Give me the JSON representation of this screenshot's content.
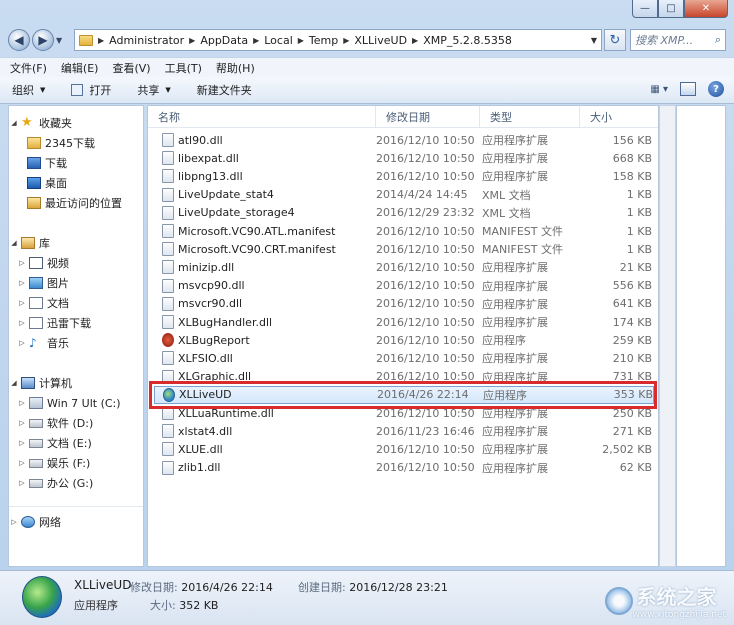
{
  "window": {
    "minimize": "—",
    "maximize": "□",
    "close": "✕"
  },
  "address": {
    "crumbs": [
      "Administrator",
      "AppData",
      "Local",
      "Temp",
      "XLLiveUD",
      "XMP_5.2.8.5358"
    ],
    "search_placeholder": "搜索 XMP..."
  },
  "menu": [
    "文件(F)",
    "编辑(E)",
    "查看(V)",
    "工具(T)",
    "帮助(H)"
  ],
  "toolbar": {
    "organize": "组织",
    "open": "打开",
    "share": "共享",
    "new_folder": "新建文件夹"
  },
  "nav": {
    "favorites": "收藏夹",
    "fav_items": [
      "2345下载",
      "下载",
      "桌面",
      "最近访问的位置"
    ],
    "library": "库",
    "lib_items": [
      "视频",
      "图片",
      "文档",
      "迅雷下载",
      "音乐"
    ],
    "computer": "计算机",
    "drives": [
      "Win 7 Ult (C:)",
      "软件 (D:)",
      "文档 (E:)",
      "娱乐 (F:)",
      "办公 (G:)"
    ],
    "network": "网络"
  },
  "columns": {
    "name": "名称",
    "date": "修改日期",
    "type": "类型",
    "size": "大小"
  },
  "files": [
    {
      "name": "atl90.dll",
      "date": "2016/12/10 10:50",
      "type": "应用程序扩展",
      "size": "156 KB",
      "icon": "dll-icon"
    },
    {
      "name": "libexpat.dll",
      "date": "2016/12/10 10:50",
      "type": "应用程序扩展",
      "size": "668 KB",
      "icon": "dll-icon"
    },
    {
      "name": "libpng13.dll",
      "date": "2016/12/10 10:50",
      "type": "应用程序扩展",
      "size": "158 KB",
      "icon": "dll-icon"
    },
    {
      "name": "LiveUpdate_stat4",
      "date": "2014/4/24 14:45",
      "type": "XML 文档",
      "size": "1 KB",
      "icon": "xml-icon"
    },
    {
      "name": "LiveUpdate_storage4",
      "date": "2016/12/29 23:32",
      "type": "XML 文档",
      "size": "1 KB",
      "icon": "xml-icon"
    },
    {
      "name": "Microsoft.VC90.ATL.manifest",
      "date": "2016/12/10 10:50",
      "type": "MANIFEST 文件",
      "size": "1 KB",
      "icon": "manifest-icon"
    },
    {
      "name": "Microsoft.VC90.CRT.manifest",
      "date": "2016/12/10 10:50",
      "type": "MANIFEST 文件",
      "size": "1 KB",
      "icon": "manifest-icon"
    },
    {
      "name": "minizip.dll",
      "date": "2016/12/10 10:50",
      "type": "应用程序扩展",
      "size": "21 KB",
      "icon": "dll-icon"
    },
    {
      "name": "msvcp90.dll",
      "date": "2016/12/10 10:50",
      "type": "应用程序扩展",
      "size": "556 KB",
      "icon": "dll-icon"
    },
    {
      "name": "msvcr90.dll",
      "date": "2016/12/10 10:50",
      "type": "应用程序扩展",
      "size": "641 KB",
      "icon": "dll-icon"
    },
    {
      "name": "XLBugHandler.dll",
      "date": "2016/12/10 10:50",
      "type": "应用程序扩展",
      "size": "174 KB",
      "icon": "dll-icon"
    },
    {
      "name": "XLBugReport",
      "date": "2016/12/10 10:50",
      "type": "应用程序",
      "size": "259 KB",
      "icon": "bug-report-icon"
    },
    {
      "name": "XLFSIO.dll",
      "date": "2016/12/10 10:50",
      "type": "应用程序扩展",
      "size": "210 KB",
      "icon": "dll-icon"
    },
    {
      "name": "XLGraphic.dll",
      "date": "2016/12/10 10:50",
      "type": "应用程序扩展",
      "size": "731 KB",
      "icon": "dll-icon"
    },
    {
      "name": "XLLiveUD",
      "date": "2016/4/26 22:14",
      "type": "应用程序",
      "size": "353 KB",
      "icon": "globe-app-icon"
    },
    {
      "name": "XLLuaRuntime.dll",
      "date": "2016/12/10 10:50",
      "type": "应用程序扩展",
      "size": "250 KB",
      "icon": "dll-icon"
    },
    {
      "name": "xlstat4.dll",
      "date": "2016/11/23 16:46",
      "type": "应用程序扩展",
      "size": "271 KB",
      "icon": "dll-icon"
    },
    {
      "name": "XLUE.dll",
      "date": "2016/12/10 10:50",
      "type": "应用程序扩展",
      "size": "2,502 KB",
      "icon": "dll-icon"
    },
    {
      "name": "zlib1.dll",
      "date": "2016/12/10 10:50",
      "type": "应用程序扩展",
      "size": "62 KB",
      "icon": "dll-icon"
    }
  ],
  "selected_index": 14,
  "details": {
    "name": "XLLiveUD",
    "kind": "应用程序",
    "modified_label": "修改日期:",
    "modified": "2016/4/26 22:14",
    "size_label": "大小:",
    "size": "352 KB",
    "created_label": "创建日期:",
    "created": "2016/12/28 23:21"
  },
  "watermark": {
    "text": "系统之家",
    "url": "www.xitongzhijia.net"
  },
  "colors": {
    "highlight_border": "#d92b2b",
    "selection": "#d3e7fb"
  }
}
